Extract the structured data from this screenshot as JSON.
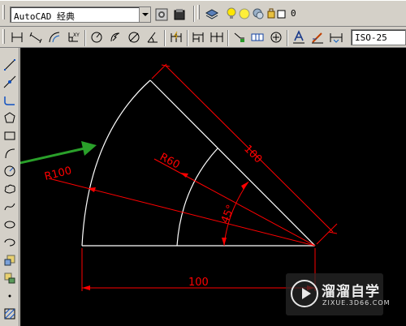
{
  "workspace": {
    "selected": "AutoCAD 经典"
  },
  "layer": {
    "selected": "0"
  },
  "dimstyle": {
    "selected": "ISO-25"
  },
  "colors": {
    "canvas": "#000000",
    "geometry": "#ffffff",
    "dimension": "#ff0000",
    "arrow": "#2aa02a"
  },
  "toolbar_icons": [
    "linear-dimension",
    "aligned-dimension",
    "arc-length-dimension",
    "ordinate-dimension",
    "radius-dimension",
    "jogged-dimension",
    "diameter-dimension",
    "angular-dimension",
    "quick-dimension",
    "baseline-dimension",
    "continue-dimension",
    "quick-leader",
    "tolerance",
    "center-mark",
    "dimension-edit",
    "dimension-text-edit",
    "dimension-update"
  ],
  "draw_tools": [
    "line",
    "construction-line",
    "polyline",
    "polygon",
    "rectangle",
    "arc",
    "circle",
    "revision-cloud",
    "spline",
    "ellipse",
    "ellipse-arc",
    "insert-block",
    "make-block",
    "point",
    "hatch"
  ],
  "drawing": {
    "dim_top": "100",
    "dim_bottom": "100",
    "radius_outer": "R100",
    "radius_inner": "R60",
    "angle": "45°"
  },
  "watermark": {
    "title": "溜溜自学",
    "url": "ZIXUE.3D66.COM"
  }
}
